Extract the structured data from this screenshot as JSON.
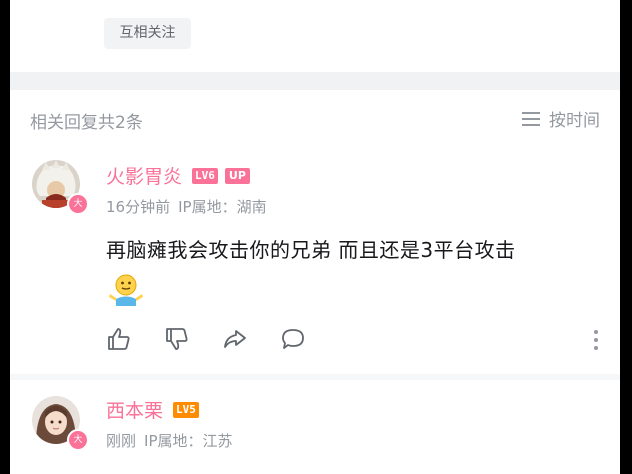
{
  "follow": {
    "mutual_label": "互相关注"
  },
  "replies": {
    "count_label": "相关回复共2条",
    "sort_label": "按时间"
  },
  "comments": [
    {
      "name": "火影胃炎",
      "level": "LV6",
      "up_tag": "UP",
      "time": "16分钟前",
      "ip": "IP属地：湖南",
      "text": "再脑瘫我会攻击你的兄弟 而且还是3平台攻击"
    },
    {
      "name": "西本栗",
      "level": "LV5",
      "time": "刚刚",
      "ip": "IP属地：江苏"
    }
  ],
  "icons": [
    "thumbs-up-icon",
    "thumbs-down-icon",
    "share-icon",
    "comment-icon",
    "more-icon",
    "sort-icon"
  ],
  "colors": {
    "accent": "#fb7299",
    "text": "#18191c",
    "muted": "#9499a0",
    "lv5": "#ff8c00"
  }
}
